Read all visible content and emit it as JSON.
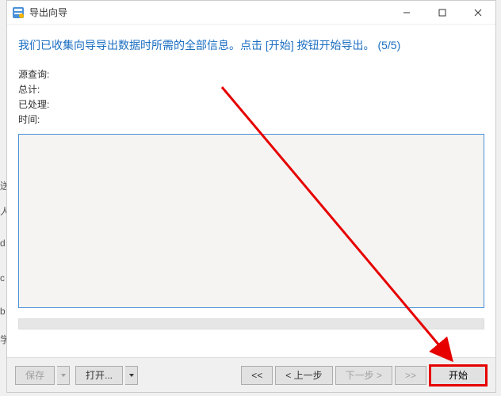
{
  "window": {
    "title": "导出向导"
  },
  "header": {
    "text": "我们已收集向导导出数据时所需的全部信息。点击 [开始] 按钮开始导出。 (5/5)"
  },
  "info": {
    "source_label": "源查询:",
    "source_value": "",
    "total_label": "总计:",
    "total_value": "",
    "processed_label": "已处理:",
    "processed_value": "",
    "time_label": "时间:",
    "time_value": ""
  },
  "log": {
    "content": ""
  },
  "footer": {
    "save": "保存",
    "open": "打开...",
    "first": "<<",
    "prev": "< 上一步",
    "next": "下一步 >",
    "last": ">>",
    "start": "开始"
  },
  "bg": {
    "l1": "送",
    "l2": "人",
    "l3": "d",
    "l4": "c",
    "l5": "b",
    "l6": "学"
  }
}
